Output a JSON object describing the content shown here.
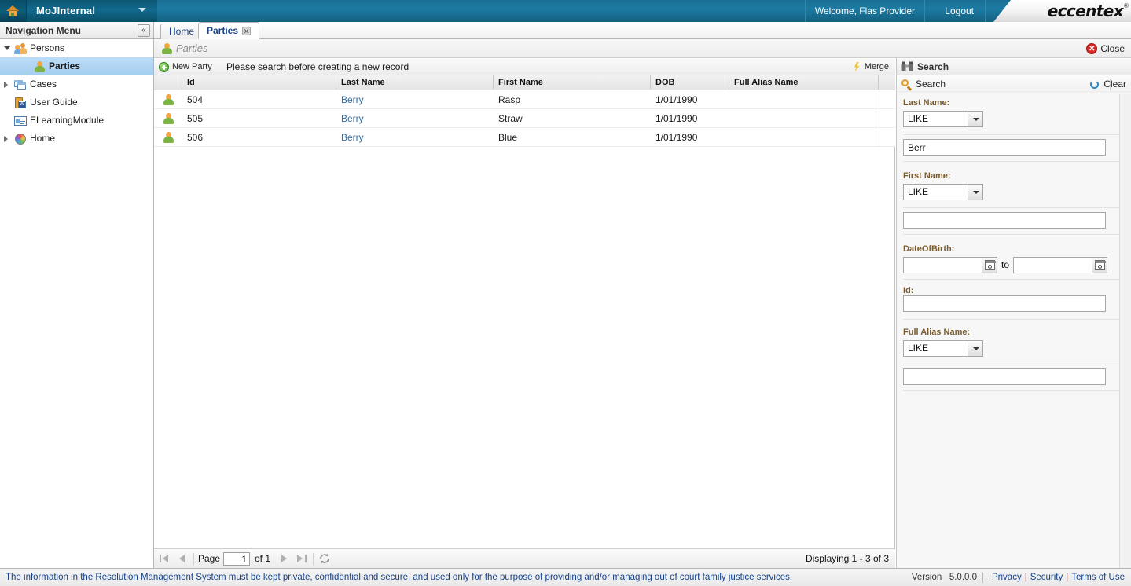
{
  "header": {
    "home_icon": "home-icon",
    "app_title": "MoJInternal",
    "app_dropdown_icon": "chevron-down-icon",
    "welcome": "Welcome, Flas Provider",
    "logout": "Logout",
    "brand": "eccentex",
    "brand_mark": "®"
  },
  "tabs": [
    {
      "label": "Home",
      "active": false,
      "closable": false
    },
    {
      "label": "Parties",
      "active": true,
      "closable": true,
      "close_icon": "close-icon"
    }
  ],
  "nav": {
    "header_title": "Navigation Menu",
    "collapse_icon": "«",
    "items": [
      {
        "label": "Persons",
        "icon": "persons-icon",
        "level": 0,
        "expander": "open",
        "selected": false
      },
      {
        "label": "Parties",
        "icon": "party-icon",
        "level": 1,
        "expander": "none",
        "selected": true
      },
      {
        "label": "Cases",
        "icon": "cases-icon",
        "level": 0,
        "expander": "closed",
        "selected": false
      },
      {
        "label": "User Guide",
        "icon": "user-guide-icon",
        "level": 0,
        "expander": "none",
        "selected": false
      },
      {
        "label": "ELearningModule",
        "icon": "elearning-icon",
        "level": 0,
        "expander": "none",
        "selected": false
      },
      {
        "label": "Home",
        "icon": "globe-icon",
        "level": 0,
        "expander": "closed",
        "selected": false
      }
    ]
  },
  "page": {
    "title": "Parties",
    "title_icon": "party-icon",
    "close_label": "Close",
    "close_icon": "close-circle-icon"
  },
  "grid_toolbar": {
    "new_party_label": "New Party",
    "new_party_icon": "plus-circle-icon",
    "message": "Please search before creating a new record",
    "merge_label": "Merge",
    "merge_icon": "lightning-bolt-icon"
  },
  "grid": {
    "columns": [
      "",
      "Id",
      "Last Name",
      "First Name",
      "DOB",
      "Full Alias Name"
    ],
    "rows": [
      {
        "icon": "party-icon",
        "id": "504",
        "last_name": "Berry",
        "first_name": "Rasp",
        "dob": "1/01/1990",
        "full_alias_name": ""
      },
      {
        "icon": "party-icon",
        "id": "505",
        "last_name": "Berry",
        "first_name": "Straw",
        "dob": "1/01/1990",
        "full_alias_name": ""
      },
      {
        "icon": "party-icon",
        "id": "506",
        "last_name": "Berry",
        "first_name": "Blue",
        "dob": "1/01/1990",
        "full_alias_name": ""
      }
    ]
  },
  "paging": {
    "first_icon": "first-page-icon",
    "prev_icon": "prev-page-icon",
    "page_label": "Page",
    "page_value": "1",
    "of_label": "of 1",
    "next_icon": "next-page-icon",
    "last_icon": "last-page-icon",
    "refresh_icon": "refresh-icon",
    "displaying": "Displaying 1 - 3 of 3"
  },
  "search": {
    "header_title": "Search",
    "header_icon": "binoculars-icon",
    "search_button": "Search",
    "search_icon": "magnifier-icon",
    "clear_button": "Clear",
    "clear_icon": "refresh-circle-icon",
    "fields": [
      {
        "label": "Last Name:",
        "operator": "LIKE",
        "value": "Berr"
      },
      {
        "label": "First Name:",
        "operator": "LIKE",
        "value": ""
      },
      {
        "label": "DateOfBirth:",
        "from": "",
        "to_label": "to",
        "to": "",
        "calendar_icon": "calendar-icon"
      },
      {
        "label": "Id:",
        "value": ""
      },
      {
        "label": "Full Alias Name:",
        "operator": "LIKE",
        "value": ""
      }
    ]
  },
  "footer": {
    "disclaimer": "The information in the Resolution Management System must be kept private, confidential and secure, and used only for the purpose of providing and/or managing out of court family justice services.",
    "version_label": "Version",
    "version_value": "5.0.0.0",
    "links": [
      {
        "label": "Privacy"
      },
      {
        "label": "Security"
      },
      {
        "label": "Terms of Use"
      }
    ]
  },
  "colors": {
    "header_blue": "#1c7ba3",
    "nav_selected": "#a4cff0",
    "link_blue": "#2d6ca8",
    "footer_link": "#15428b",
    "label_brown": "#7a5c2e"
  }
}
